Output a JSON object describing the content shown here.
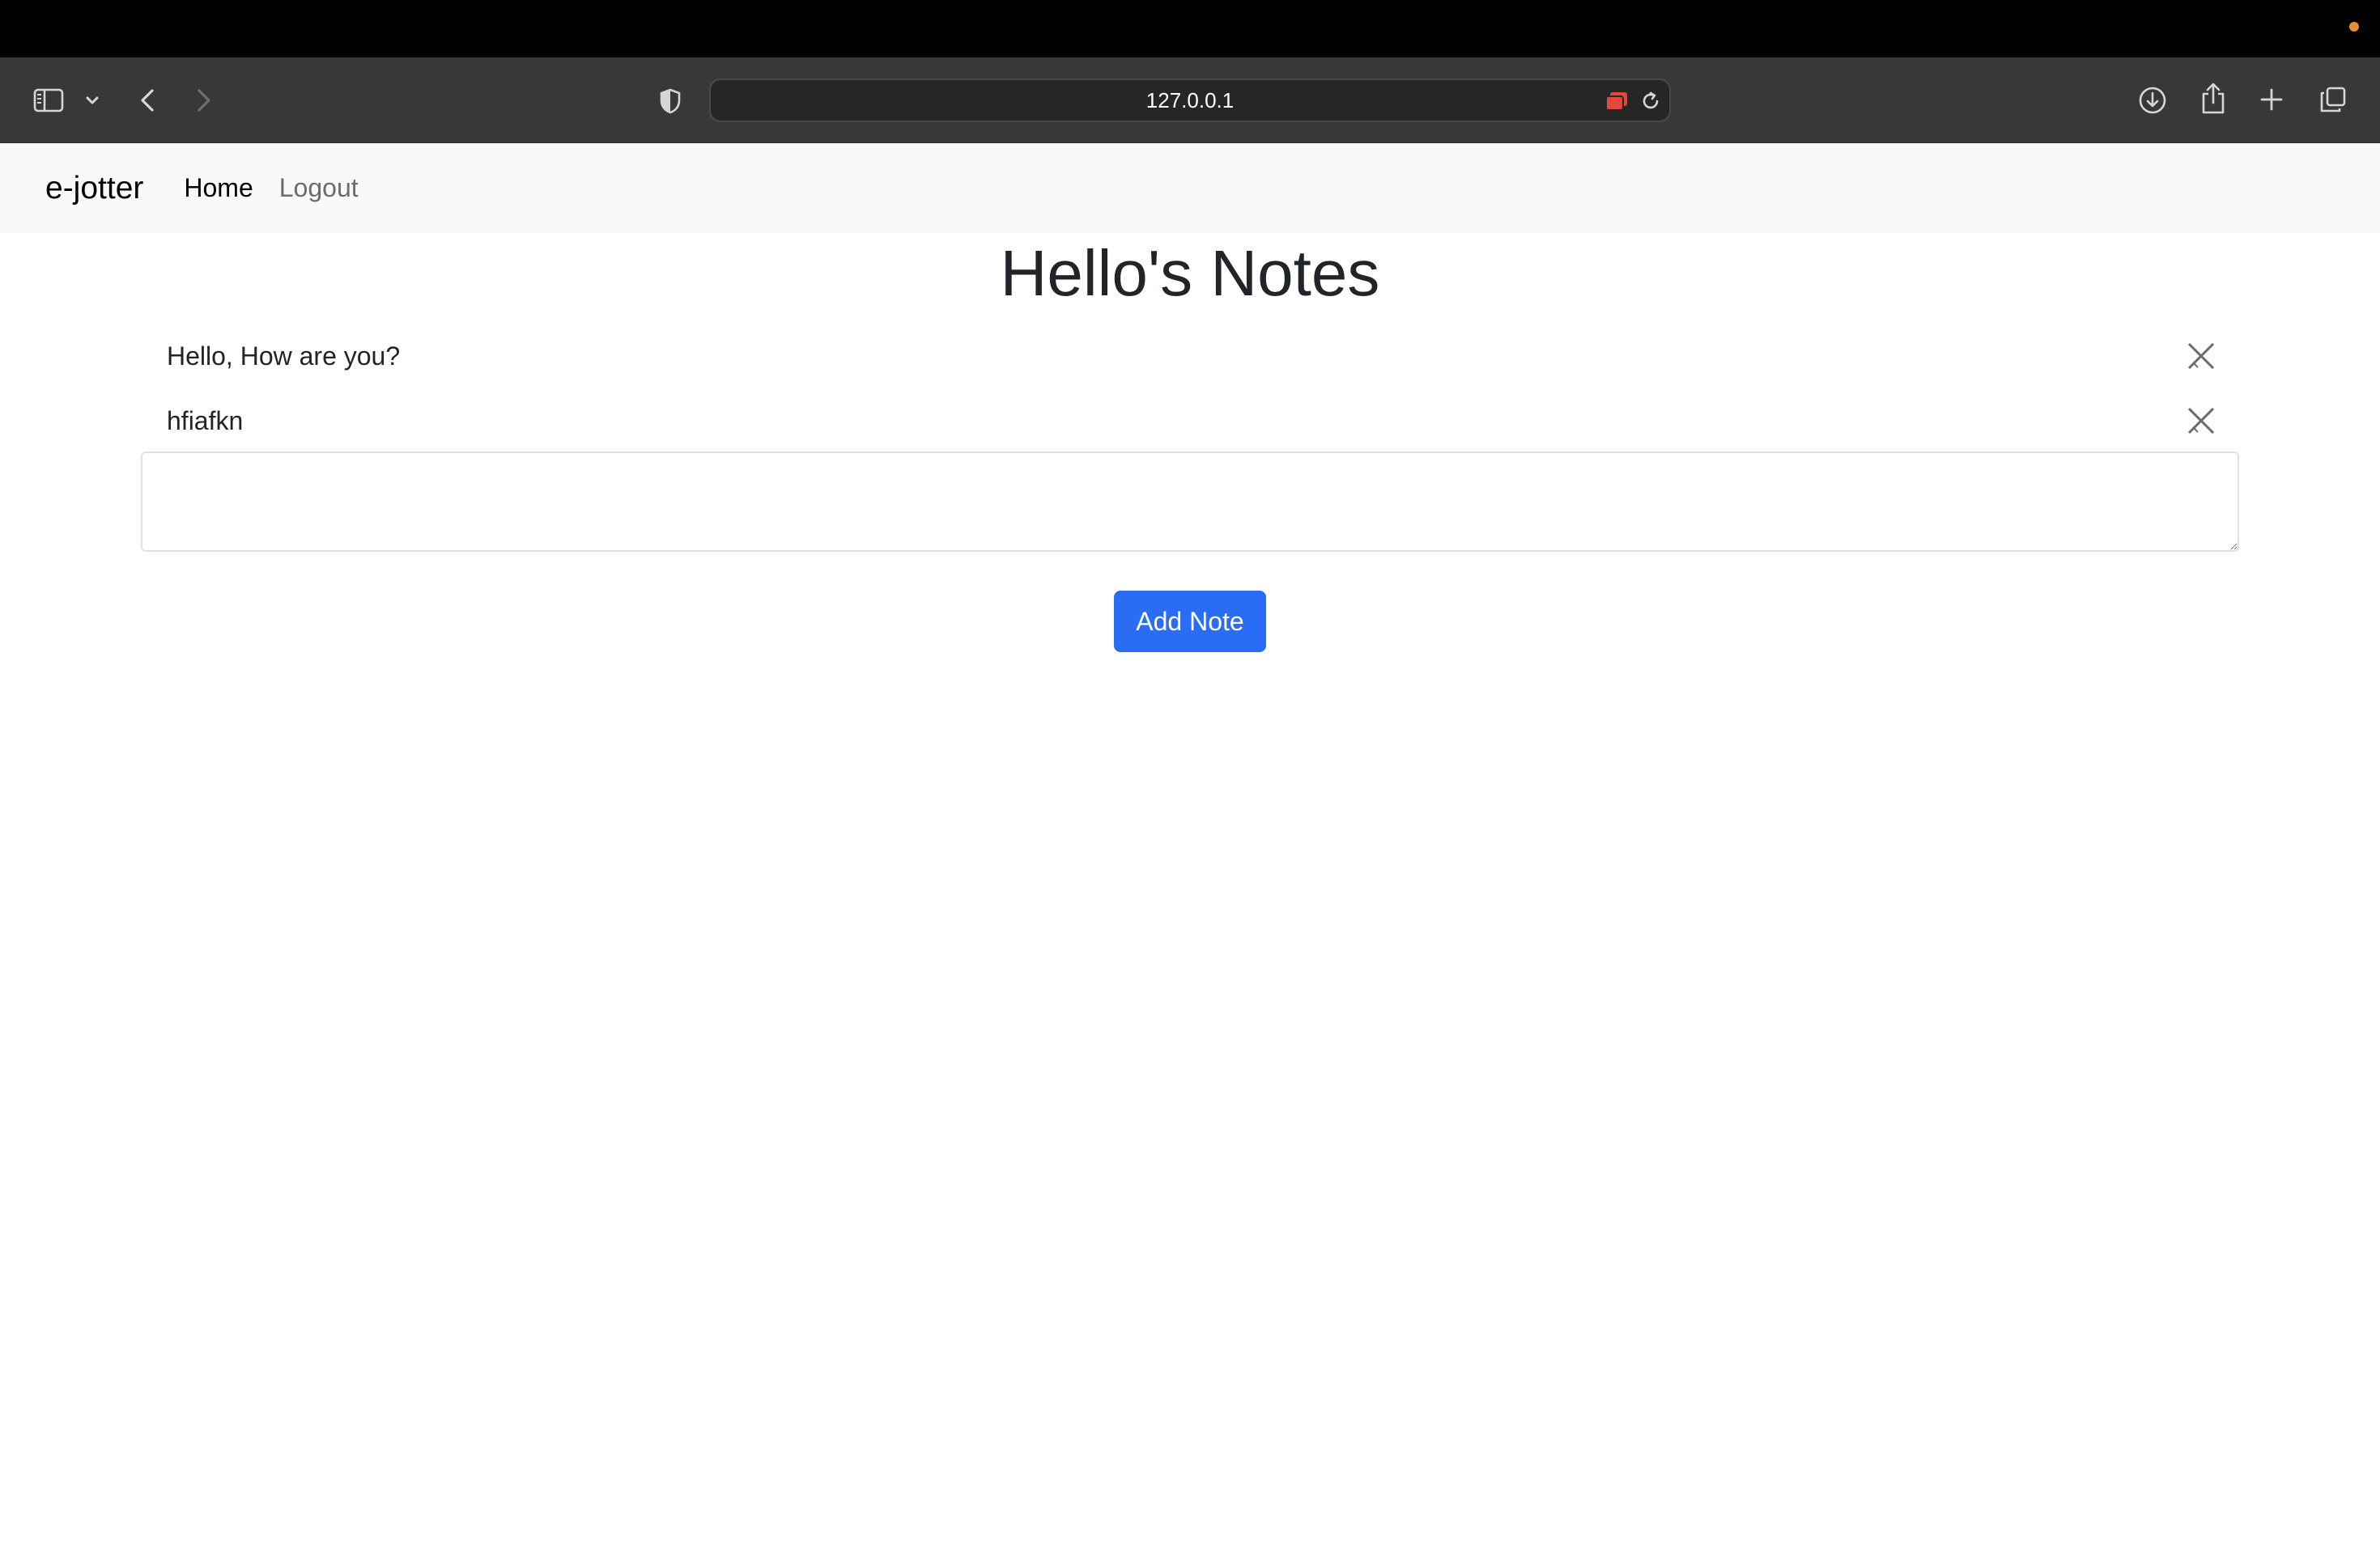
{
  "browser": {
    "url": "127.0.0.1",
    "icons": [
      "sidebar-icon",
      "chevron-down-icon",
      "back-icon",
      "forward-icon",
      "privacy-shield-icon",
      "extension-icon",
      "reload-icon",
      "download-icon",
      "share-icon",
      "new-tab-icon",
      "tabs-overview-icon"
    ],
    "colors": {
      "menubar": "#000000",
      "toolbar": "#383838",
      "urlbar": "#262626",
      "status_dot": "#e8902a",
      "extension": "#e5483b"
    }
  },
  "navbar": {
    "brand": "e-jotter",
    "links": [
      {
        "label": "Home"
      },
      {
        "label": "Logout"
      }
    ]
  },
  "main": {
    "title": "Hello's Notes",
    "notes": [
      {
        "text": "Hello, How are you?"
      },
      {
        "text": "hfiafkn"
      }
    ],
    "new_note": {
      "value": "",
      "placeholder": ""
    },
    "add_button_label": "Add Note",
    "delete_icon": "close-icon"
  },
  "colors": {
    "accent": "#2b6cf5",
    "navbar_bg": "#f8f9fa",
    "text": "#212529"
  }
}
